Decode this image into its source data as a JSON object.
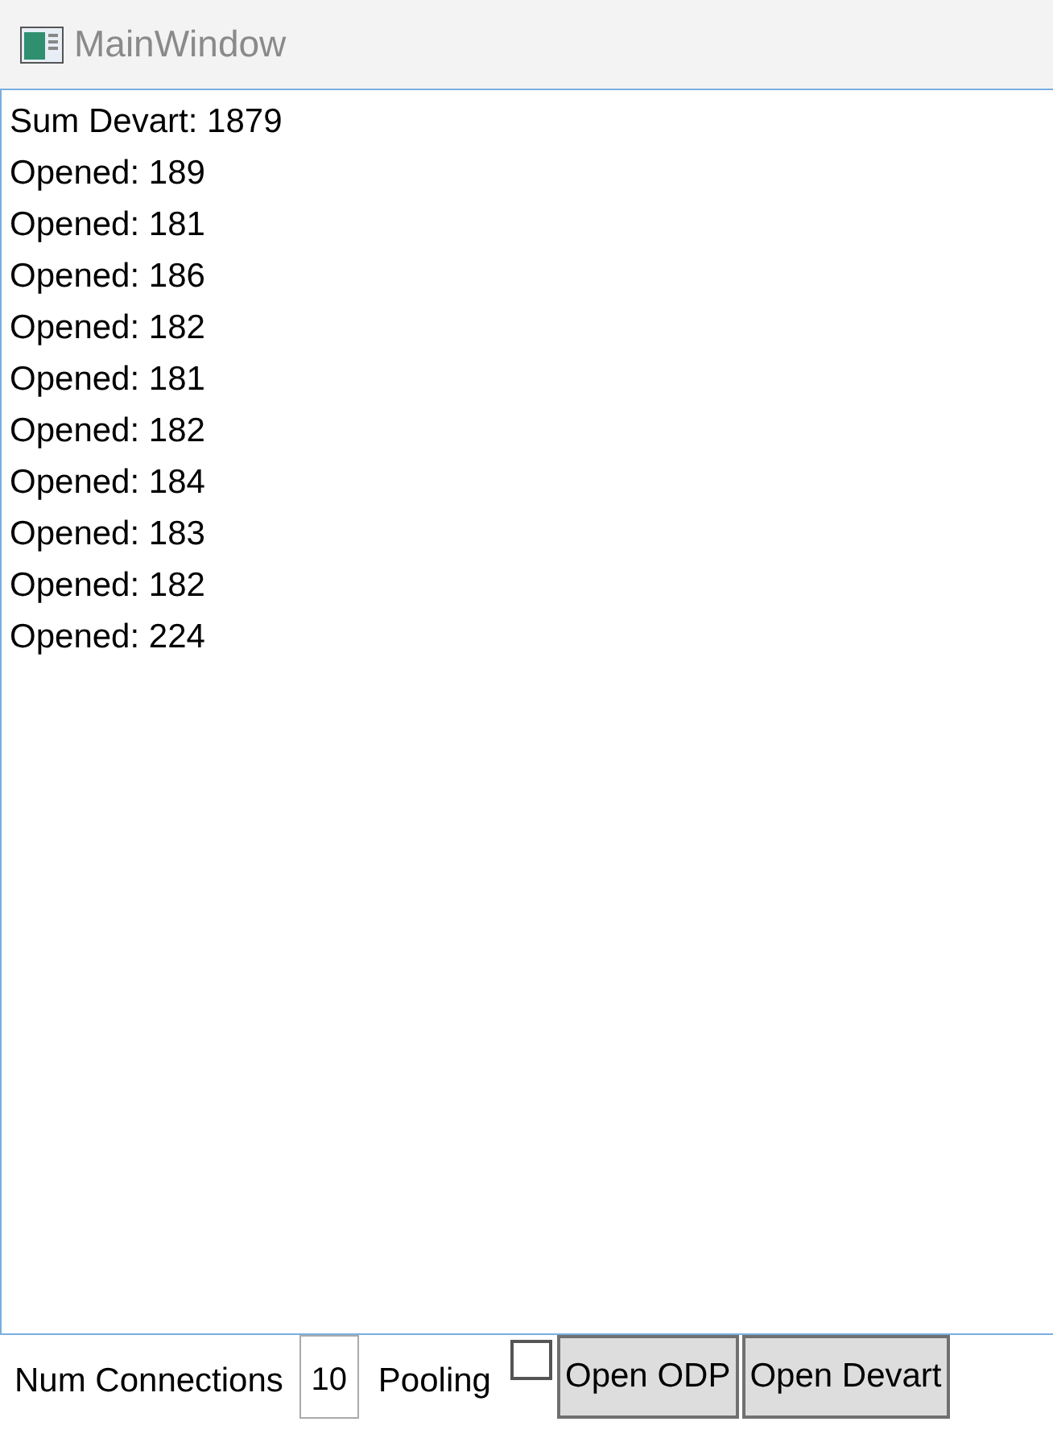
{
  "window": {
    "title": "MainWindow"
  },
  "log": [
    "Sum Devart: 1879",
    "Opened: 189",
    "Opened: 181",
    "Opened: 186",
    "Opened: 182",
    "Opened: 181",
    "Opened: 182",
    "Opened: 184",
    "Opened: 183",
    "Opened: 182",
    "Opened: 224"
  ],
  "toolbar": {
    "connections_label": "Num Connections",
    "connections_value": "10",
    "pooling_label": "Pooling",
    "pooling_checked": false,
    "buttons": [
      "Open ODP",
      "Open Devart"
    ]
  }
}
